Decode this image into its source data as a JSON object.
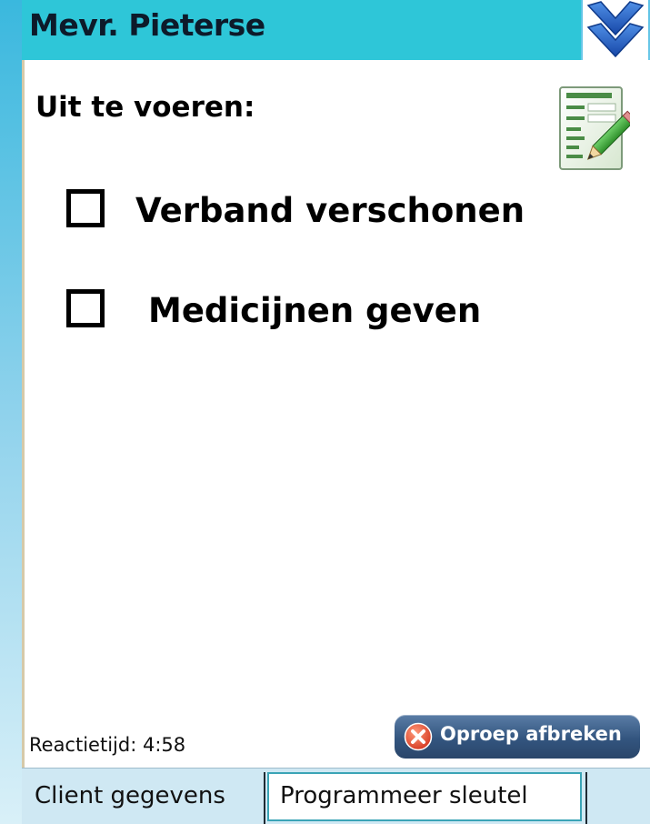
{
  "header": {
    "title": "Mevr. Pieterse"
  },
  "content": {
    "section_title": "Uit te voeren:",
    "tasks": [
      {
        "label": "Verband verschonen",
        "checked": false
      },
      {
        "label": "Medicijnen geven",
        "checked": false
      }
    ]
  },
  "footer": {
    "reaction_time": "Reactietijd: 4:58",
    "cancel_call_label": "Oproep afbreken"
  },
  "tabs": [
    {
      "label": "Client gegevens",
      "active": false
    },
    {
      "label": "Programmeer sleutel",
      "active": true
    }
  ],
  "icons": {
    "collapse": "double-chevron-down-icon",
    "edit": "edit-notes-icon",
    "cancel": "close-circle-icon"
  },
  "colors": {
    "header_bg": "#2ec6d8",
    "chevron": "#1f5fc4",
    "cancel_button": "#33557f",
    "cancel_x": "#e0452c"
  }
}
